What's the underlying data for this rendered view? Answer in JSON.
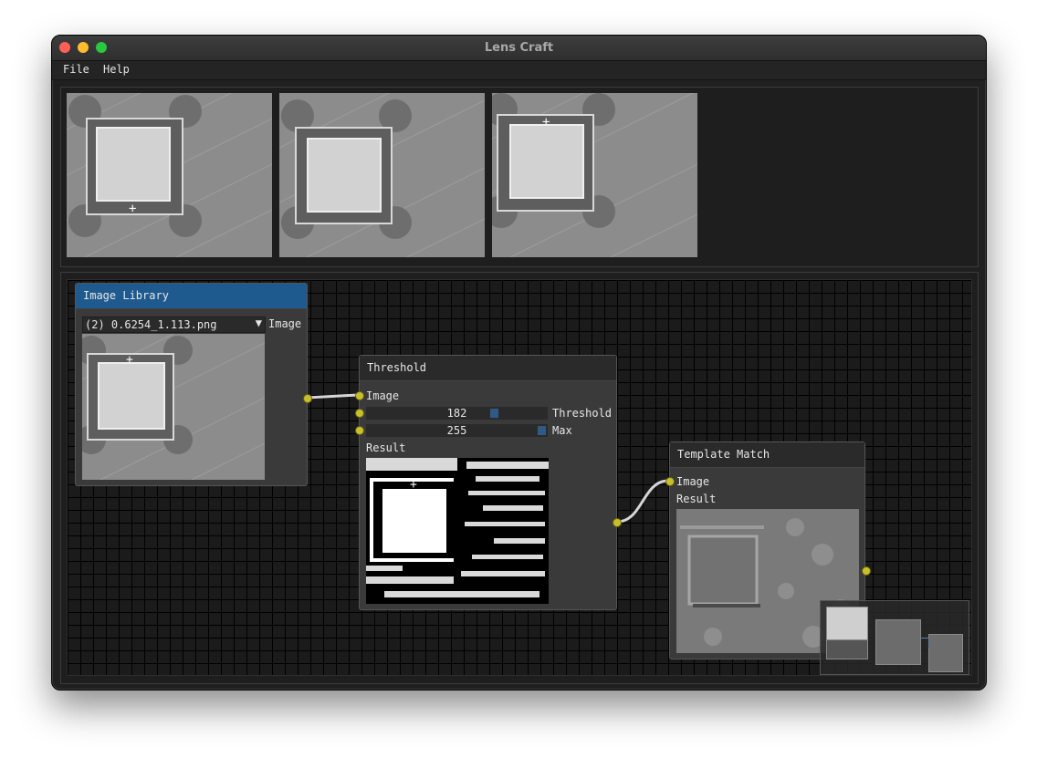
{
  "window": {
    "title": "Lens Craft"
  },
  "menu": {
    "items": [
      "File",
      "Help"
    ]
  },
  "gallery": {
    "images": [
      "thumbnail-1",
      "thumbnail-2",
      "thumbnail-3"
    ]
  },
  "nodes": {
    "image_library": {
      "title": "Image Library",
      "selected_file": "(2) 0.6254_1.113.png",
      "output_label": "Image"
    },
    "threshold": {
      "title": "Threshold",
      "input_label": "Image",
      "threshold_value": "182",
      "threshold_label": "Threshold",
      "max_value": "255",
      "max_label": "Max",
      "result_label": "Result"
    },
    "template_match": {
      "title": "Template Match",
      "input_label": "Image",
      "result_label": "Result"
    }
  },
  "colors": {
    "pin": "#c8c02a",
    "selected_header": "#1f5a8e",
    "slider_grab": "#2f5a85"
  }
}
